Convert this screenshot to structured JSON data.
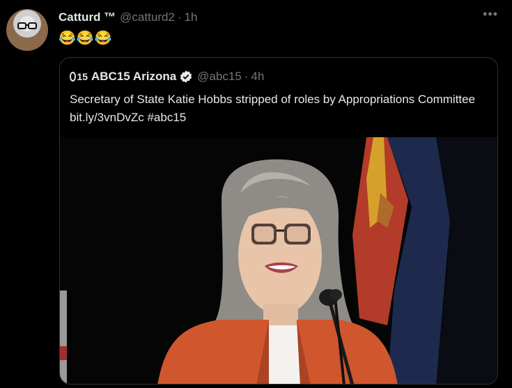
{
  "tweet": {
    "display_name": "Catturd ™",
    "handle": "@catturd2",
    "separator": "·",
    "time": "1h",
    "text": "😂😂😂",
    "more_icon": "more-icon"
  },
  "quoted": {
    "display_name": "ABC15 Arizona",
    "logo_text": "15",
    "handle": "@abc15",
    "separator": "·",
    "time": "4h",
    "text": "Secretary of State Katie Hobbs stripped of roles by Appropriations Committee bit.ly/3vnDvZc #abc15",
    "verified_icon": "verified-badge-icon"
  },
  "colors": {
    "background": "#000000",
    "primary_text": "#e7e9ea",
    "secondary_text": "#71767b",
    "border": "#2f3336",
    "jacket": "#d0562e"
  }
}
